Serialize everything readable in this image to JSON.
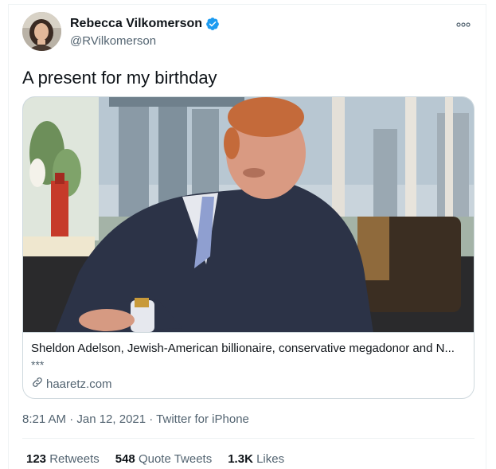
{
  "author": {
    "display_name": "Rebecca Vilkomerson",
    "handle": "@RVilkomerson",
    "verified": true
  },
  "tweet": {
    "text": "A present for my birthday",
    "timestamp": "8:21 AM · Jan 12, 2021",
    "separator": " · ",
    "source": "Twitter for iPhone"
  },
  "card": {
    "title": "Sheldon Adelson, Jewish-American billionaire, conservative megadonor and N...",
    "description": "***",
    "domain": "haaretz.com"
  },
  "stats": {
    "retweets_count": "123",
    "retweets_label": "Retweets",
    "quotes_count": "548",
    "quotes_label": "Quote Tweets",
    "likes_count": "1.3K",
    "likes_label": "Likes"
  },
  "icons": {
    "verified": "verified-badge-icon",
    "more": "more-options-icon",
    "link": "link-icon"
  },
  "colors": {
    "verified_blue": "#1d9bf0",
    "secondary_text": "#536471",
    "border": "#cfd9de"
  }
}
